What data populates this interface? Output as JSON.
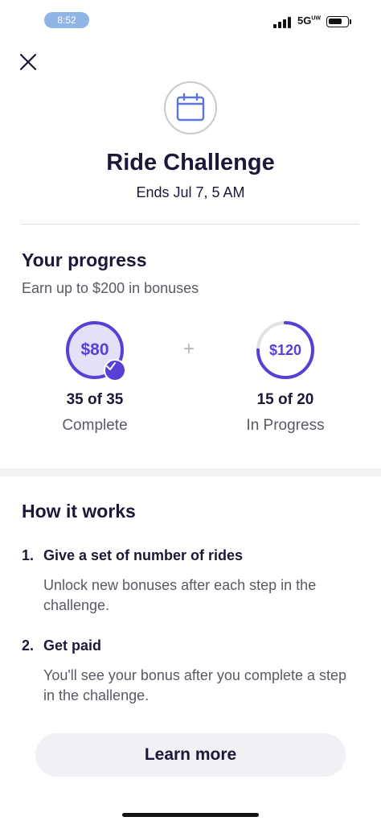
{
  "status_bar": {
    "time": "8:52",
    "network": "5G",
    "network_suffix": "UW",
    "battery_level": 0.75
  },
  "header": {
    "title": "Ride Challenge",
    "subtitle": "Ends Jul 7, 5 AM",
    "icon": "calendar-icon"
  },
  "progress": {
    "title": "Your progress",
    "subtitle": "Earn up to $200 in bonuses",
    "separator": "+",
    "bonuses": [
      {
        "amount": "$80",
        "count": "35 of 35",
        "status": "Complete",
        "progress": 1.0,
        "completed": true
      },
      {
        "amount": "$120",
        "count": "15 of 20",
        "status": "In Progress",
        "progress": 0.75,
        "completed": false
      }
    ]
  },
  "how_it_works": {
    "title": "How it works",
    "steps": [
      {
        "number": "1.",
        "title": "Give a set of number of rides",
        "body": "Unlock new bonuses after each step in the challenge."
      },
      {
        "number": "2.",
        "title": "Get paid",
        "body": "You'll see your bonus after you complete a step in the challenge."
      }
    ]
  },
  "learn_more_label": "Learn more",
  "colors": {
    "accent": "#5a3fd6",
    "accent_light": "#e4e0f7",
    "text": "#1b1838",
    "muted": "#5b5866"
  }
}
